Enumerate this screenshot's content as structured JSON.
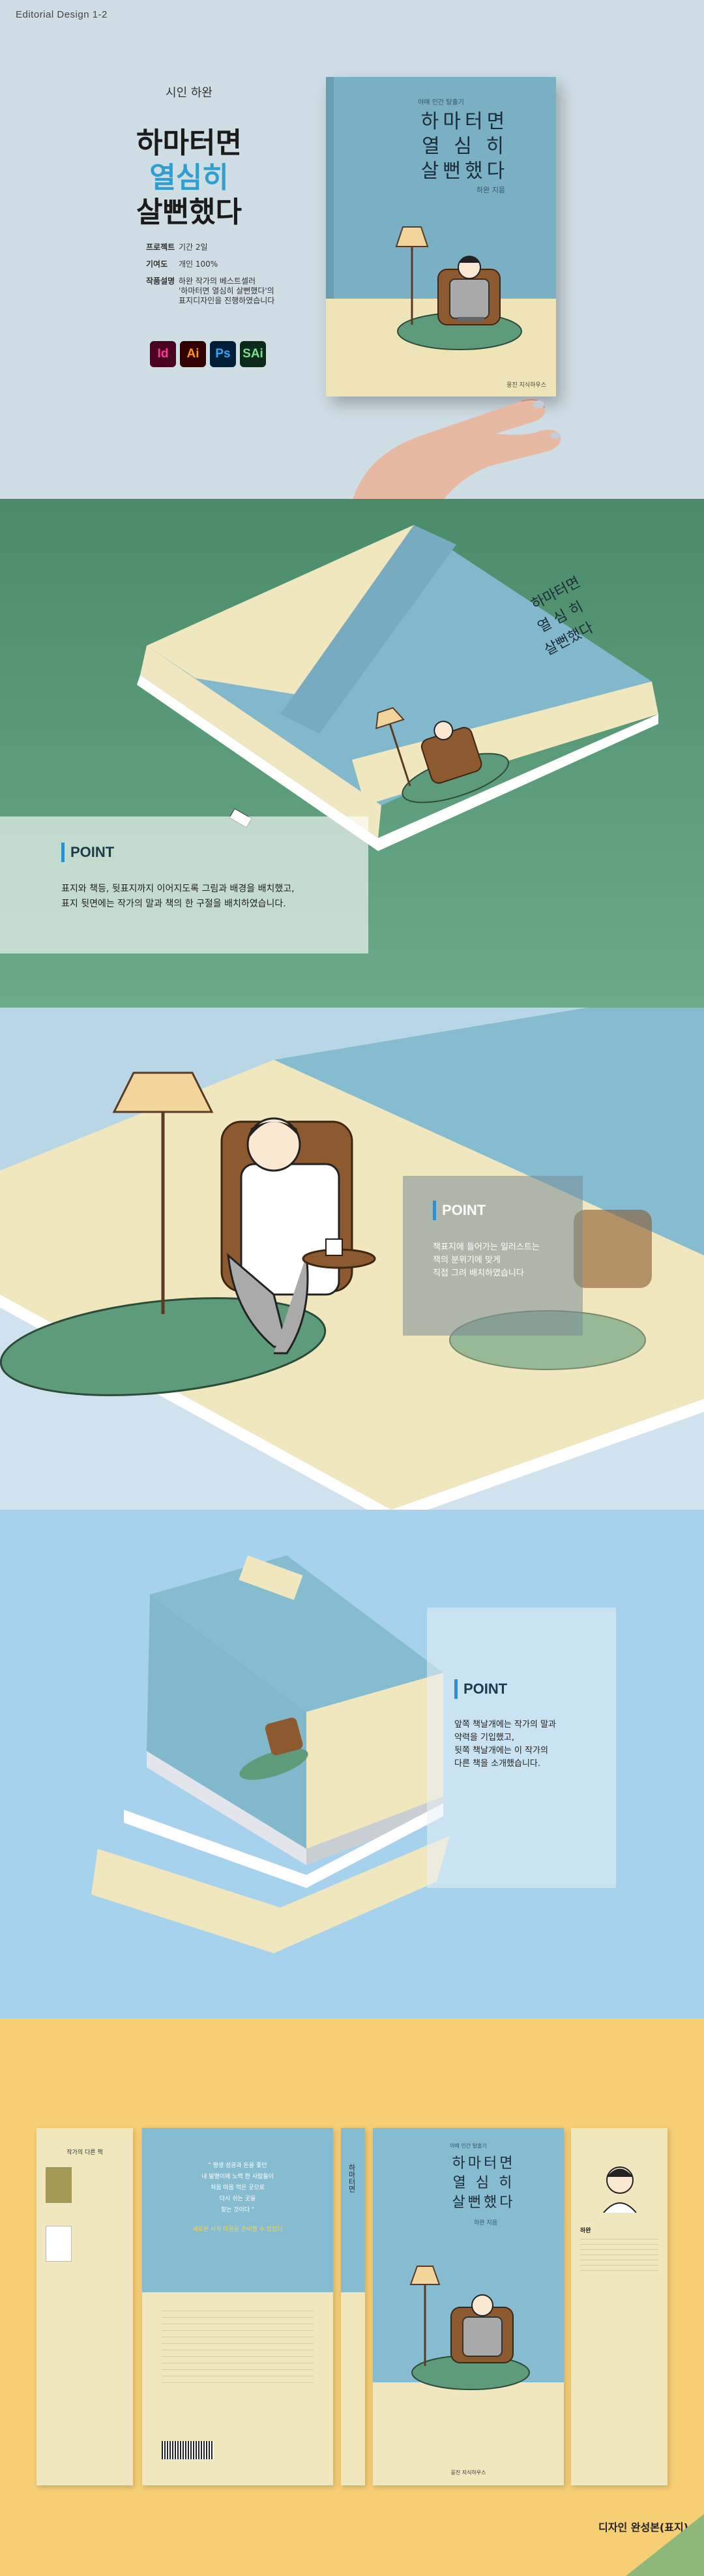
{
  "header": {
    "label": "Editorial Design 1-2"
  },
  "book": {
    "subtitle": "시인 하완",
    "title_line1": "하마터면",
    "title_line2": "열심히",
    "title_line3": "살뻔했다",
    "cover_tag": "야매 인간 탈출기",
    "cover_title": "하마터면\n열 심 히\n살뻔했다",
    "cover_author": "하완 지음",
    "publisher": "웅진 지식하우스"
  },
  "project_info": {
    "items": [
      {
        "label": "프로젝트",
        "value": "기간 2일"
      },
      {
        "label": "기여도",
        "value": "개인 100%"
      },
      {
        "label": "작품설명",
        "value": "하완 작가의 베스트셀러\n'하마터면 열심히 살뻔했다'의\n표지디자인을 진행하였습니다"
      }
    ]
  },
  "apps": [
    {
      "name": "Id",
      "color": "#ff3a9c"
    },
    {
      "name": "Ai",
      "color": "#ff9a00"
    },
    {
      "name": "Ps",
      "color": "#31a8ff"
    },
    {
      "name": "SAi",
      "color": "#78e08f"
    }
  ],
  "colors": {
    "accent": "#2f9fd0",
    "cover_blue": "#7ab0c3",
    "cover_cream": "#efe4b8"
  },
  "points": [
    {
      "title": "POINT",
      "desc": "표지와 책등, 뒷표지까지 이어지도록 그림과 배경을 배치했고,\n표지 뒷면에는 작가의 말과 책의 한 구절을 배치하였습니다."
    },
    {
      "title": "POINT",
      "desc": "책표지에 들어가는 일러스트는\n책의 분위기에 맞게\n직접 그려 배치하였습니다"
    },
    {
      "title": "POINT",
      "desc": "앞쪽 책날개에는 작가의 말과\n약력을 기입했고,\n뒷쪽 책날개에는 이 작가의\n다른 책을 소개했습니다."
    }
  ],
  "flat": {
    "back_flap_heading": "작가의 다른 책",
    "back_quote": "\" 평생 성공과 돈을 좇던\n내 발명이에 노력 한 사람들이 \n처음 마음 먹은 곳으로\n다시 쉬는 곳을 \n찾는 것이다 \"",
    "back_quote_highlight": "새로운 시작 마음을 준비할 수 있었다",
    "author_name": "하완",
    "credit": "디자인 완성본(표지)"
  }
}
